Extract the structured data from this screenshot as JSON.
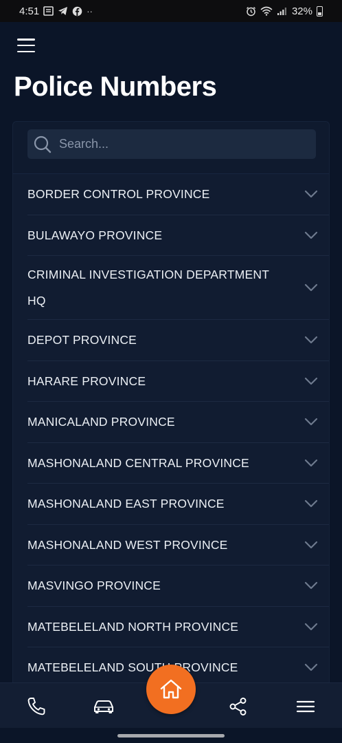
{
  "status_bar": {
    "time": "4:51",
    "overflow": "··",
    "battery": "32%",
    "icons": [
      "news-icon",
      "telegram-icon",
      "facebook-icon",
      "alarm-icon",
      "wifi-icon",
      "signal-icon",
      "battery-icon"
    ]
  },
  "header": {
    "title": "Police Numbers",
    "menu_icon": "hamburger-icon"
  },
  "search": {
    "placeholder": "Search..."
  },
  "provinces": [
    "BORDER CONTROL PROVINCE",
    "BULAWAYO PROVINCE",
    "CRIMINAL INVESTIGATION DEPARTMENT HQ",
    "DEPOT PROVINCE",
    "HARARE PROVINCE",
    "MANICALAND PROVINCE",
    "MASHONALAND CENTRAL PROVINCE",
    "MASHONALAND EAST PROVINCE",
    "MASHONALAND WEST PROVINCE",
    "MASVINGO PROVINCE",
    "MATEBELELAND NORTH PROVINCE",
    "MATEBELELAND SOUTH PROVINCE"
  ],
  "bottom_nav": {
    "items": [
      "phone-icon",
      "car-icon",
      "home-icon",
      "share-icon",
      "menu-icon"
    ],
    "accent": "#f26f21"
  },
  "colors": {
    "background": "#0b1528",
    "card": "#111c31",
    "accent": "#f26f21"
  }
}
